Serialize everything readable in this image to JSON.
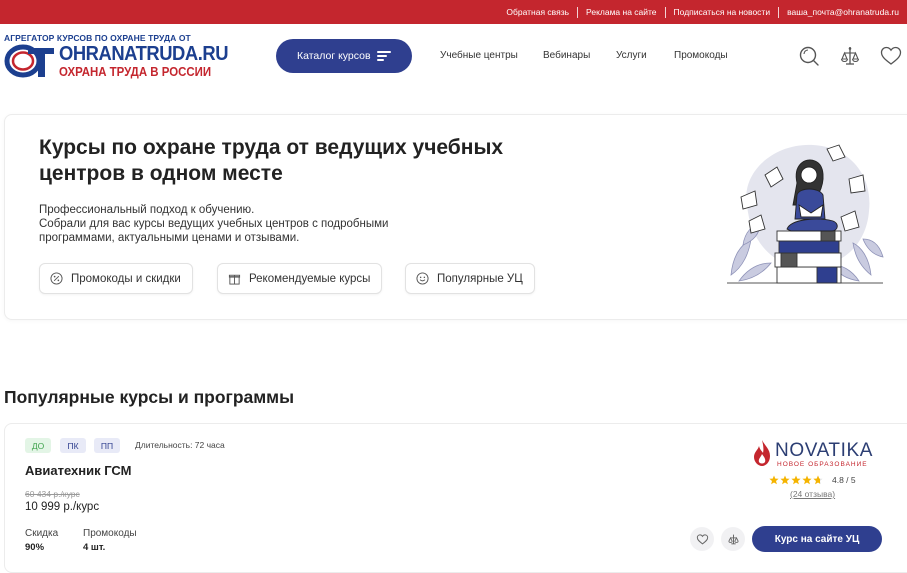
{
  "topbar": {
    "links": [
      "Обратная связь",
      "Реклама на сайте",
      "Подписаться на новости",
      "ваша_почта@ohranatruda.ru"
    ]
  },
  "logo": {
    "tagline": "АГРЕГАТОР КУРСОВ ПО ОХРАНЕ ТРУДА ОТ",
    "brand": "OHRANATRUDA.RU",
    "brand_subtitle": "ОХРАНА ТРУДА В РОССИИ"
  },
  "header": {
    "catalog_label": "Каталог курсов",
    "nav": [
      "Учебные центры",
      "Вебинары",
      "Услуги",
      "Промокоды"
    ],
    "icons": [
      "search-icon",
      "compare-icon",
      "heart-icon"
    ]
  },
  "hero": {
    "title": "Курсы по охране труда от ведущих учебных центров в одном месте",
    "desc_line1": "Профессиональный подход к обучению.",
    "desc_line2": "Собрали для вас курсы ведущих учебных центров с подробными программами, актуальными ценами и отзывами.",
    "pills": [
      {
        "label": "Промокоды и скидки",
        "icon": "percent-icon"
      },
      {
        "label": "Рекомендуемые курсы",
        "icon": "gift-icon"
      },
      {
        "label": "Популярные УЦ",
        "icon": "smile-icon"
      }
    ]
  },
  "section_title": "Популярные курсы и программы",
  "course": {
    "tags": [
      {
        "label": "ДО",
        "bg": "#e3f5e6",
        "color": "#3fa34d"
      },
      {
        "label": "ПК",
        "bg": "#e8eaf7",
        "color": "#2f3f8f"
      },
      {
        "label": "ПП",
        "bg": "#e8eaf7",
        "color": "#2f3f8f"
      }
    ],
    "duration": "Длительность: 72 часа",
    "title": "Авиатехник ГСМ",
    "old_price": "60 434 р./курс",
    "new_price": "10 999 р./курс",
    "discount_label": "Скидка",
    "discount_value": "90%",
    "promo_label": "Промокоды",
    "promo_value": "4 шт.",
    "provider": {
      "name": "NOVATIKA",
      "subtitle": "НОВОЕ ОБРАЗОВАНИЕ",
      "rating": "4.8 / 5",
      "rating_value": 4.8,
      "reviews": "(24 отзыва)"
    },
    "cta_label": "Курс на сайте УЦ"
  },
  "colors": {
    "brand_red": "#c4262e",
    "brand_blue": "#2f3f8f",
    "star": "#f5b400"
  }
}
